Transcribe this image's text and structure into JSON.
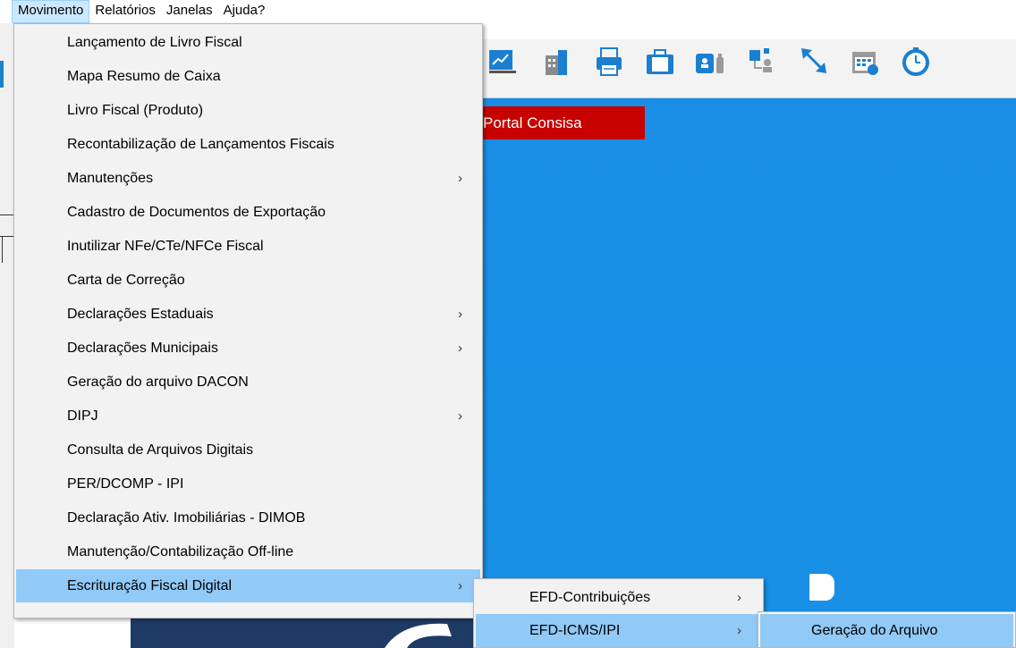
{
  "menubar": {
    "items": [
      {
        "label": "Movimento"
      },
      {
        "label": "Relatórios"
      },
      {
        "label": "Janelas"
      },
      {
        "label": "Ajuda?"
      }
    ]
  },
  "portal_button": {
    "label": "Portal Consisa"
  },
  "main_menu": {
    "items": [
      {
        "label": "Lançamento de Livro Fiscal",
        "submenu": false
      },
      {
        "label": "Mapa Resumo de Caixa",
        "submenu": false
      },
      {
        "label": "Livro Fiscal (Produto)",
        "submenu": false
      },
      {
        "label": "Recontabilização de Lançamentos Fiscais",
        "submenu": false
      },
      {
        "label": "Manutenções",
        "submenu": true
      },
      {
        "label": "Cadastro de Documentos de Exportação",
        "submenu": false
      },
      {
        "label": "Inutilizar NFe/CTe/NFCe Fiscal",
        "submenu": false
      },
      {
        "label": "Carta de Correção",
        "submenu": false
      },
      {
        "label": "Declarações Estaduais",
        "submenu": true
      },
      {
        "label": "Declarações Municipais",
        "submenu": true
      },
      {
        "label": "Geração do arquivo DACON",
        "submenu": false
      },
      {
        "label": "DIPJ",
        "submenu": true
      },
      {
        "label": "Consulta de Arquivos Digitais",
        "submenu": false
      },
      {
        "label": "PER/DCOMP - IPI",
        "submenu": false
      },
      {
        "label": "Declaração Ativ. Imobiliárias - DIMOB",
        "submenu": false
      },
      {
        "label": "Manutenção/Contabilização Off-line",
        "submenu": false
      },
      {
        "label": "Escrituração Fiscal Digital",
        "submenu": true,
        "highlighted": true
      }
    ]
  },
  "submenu_efd": {
    "items": [
      {
        "label": "EFD-Contribuições",
        "submenu": true
      },
      {
        "label": "EFD-ICMS/IPI",
        "submenu": true,
        "highlighted": true
      }
    ]
  },
  "submenu_icms": {
    "items": [
      {
        "label": "Geração do Arquivo",
        "highlighted": true
      }
    ]
  },
  "arrow_glyph": "›",
  "colors": {
    "menu_highlight": "#91c9f7",
    "menubar_active": "#cce8ff",
    "portal_red": "#c70000",
    "background_blue": "#1a8de6"
  },
  "toolbar_icons": [
    "chart-icon",
    "building-icon",
    "printer-icon",
    "briefcase-icon",
    "person-tools-icon",
    "network-user-icon",
    "resize-arrow-icon",
    "calendar-icon",
    "clock-icon"
  ]
}
